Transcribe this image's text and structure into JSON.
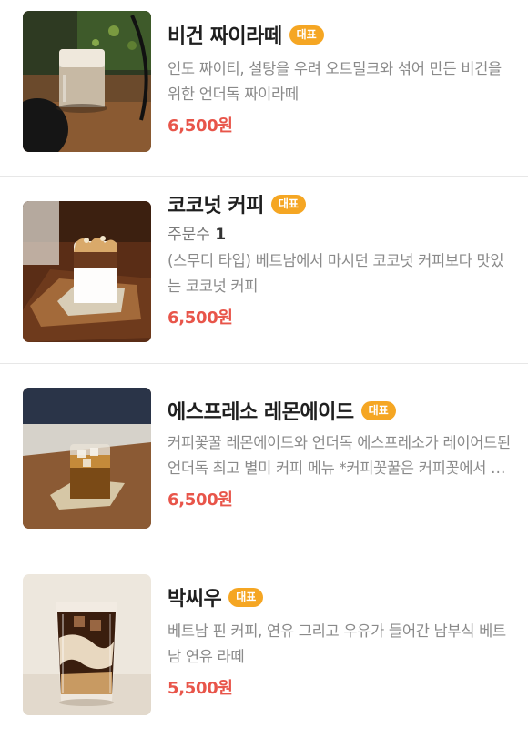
{
  "colors": {
    "badge": "#f5a623",
    "price": "#e8554a",
    "title": "#1f1f1f",
    "description": "#8a8a8a"
  },
  "items": [
    {
      "name": "비건 짜이라떼",
      "badge": "대표",
      "description": "인도 짜이티, 설탕을 우려 오트밀크와 섞어 만든 비건을 위한 언더독 짜이라떼",
      "price": "6,500원"
    },
    {
      "name": "코코넛 커피",
      "badge": "대표",
      "order_label": "주문수",
      "order_count": "1",
      "description": "(스무디 타입) 베트남에서 마시던 코코넛 커피보다 맛있는 코코넛 커피",
      "price": "6,500원"
    },
    {
      "name": "에스프레소 레몬에이드",
      "badge": "대표",
      "description": "커피꽃꿀 레몬에이드와 언더독 에스프레소가 레이어드된 언더독 최고 별미 커피 메뉴 *커피꽃꿀은 커피꽃에서 채취한 꿀입니다",
      "price": "6,500원"
    },
    {
      "name": "박씨우",
      "badge": "대표",
      "description": "베트남 핀 커피, 연유 그리고 우유가 들어간 남부식 베트남 연유 라떼",
      "price": "5,500원"
    }
  ]
}
